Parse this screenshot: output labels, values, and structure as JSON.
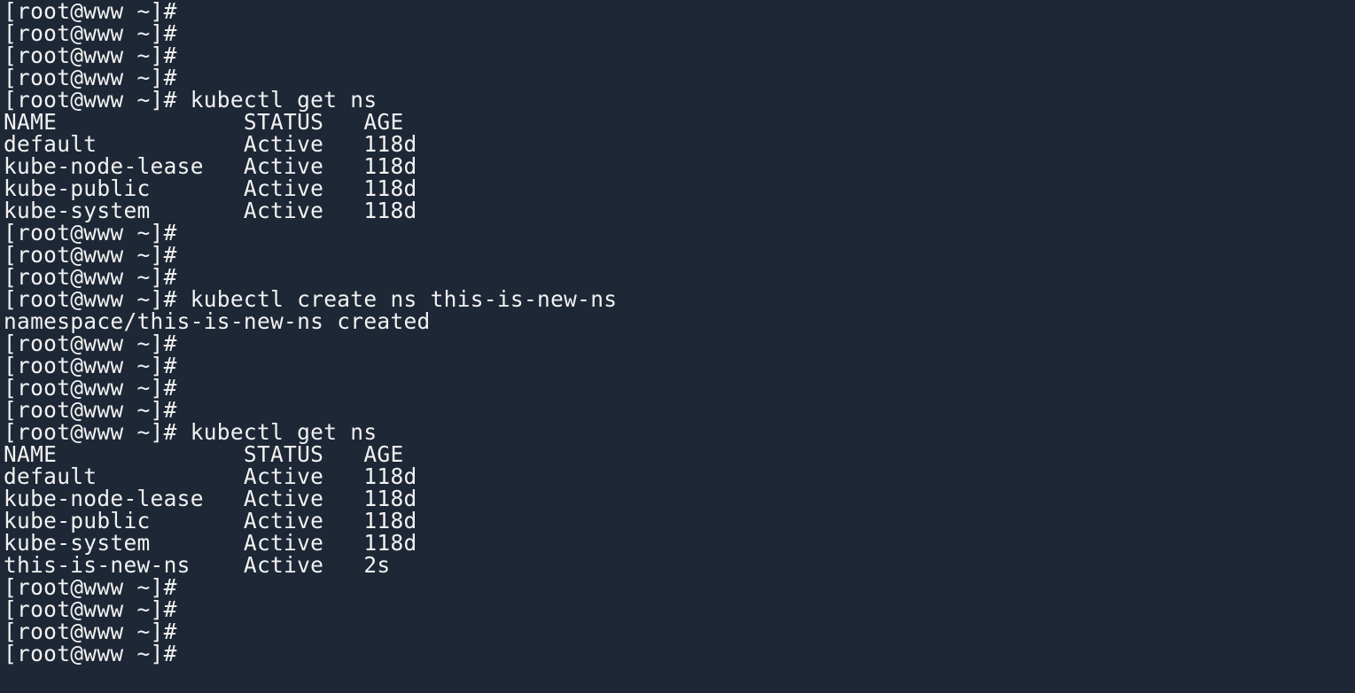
{
  "terminal": {
    "background": "#1e2735",
    "foreground": "#f2f2f2",
    "prompt": "[root@www ~]#",
    "lines": [
      {
        "type": "prompt",
        "command": ""
      },
      {
        "type": "prompt",
        "command": ""
      },
      {
        "type": "prompt",
        "command": ""
      },
      {
        "type": "prompt",
        "command": ""
      },
      {
        "type": "prompt",
        "command": " kubectl get ns"
      },
      {
        "type": "output",
        "text": "NAME              STATUS   AGE"
      },
      {
        "type": "output",
        "text": "default           Active   118d"
      },
      {
        "type": "output",
        "text": "kube-node-lease   Active   118d"
      },
      {
        "type": "output",
        "text": "kube-public       Active   118d"
      },
      {
        "type": "output",
        "text": "kube-system       Active   118d"
      },
      {
        "type": "prompt",
        "command": ""
      },
      {
        "type": "prompt",
        "command": ""
      },
      {
        "type": "prompt",
        "command": ""
      },
      {
        "type": "prompt",
        "command": " kubectl create ns this-is-new-ns"
      },
      {
        "type": "output",
        "text": "namespace/this-is-new-ns created"
      },
      {
        "type": "prompt",
        "command": ""
      },
      {
        "type": "prompt",
        "command": ""
      },
      {
        "type": "prompt",
        "command": ""
      },
      {
        "type": "prompt",
        "command": ""
      },
      {
        "type": "prompt",
        "command": " kubectl get ns"
      },
      {
        "type": "output",
        "text": "NAME              STATUS   AGE"
      },
      {
        "type": "output",
        "text": "default           Active   118d"
      },
      {
        "type": "output",
        "text": "kube-node-lease   Active   118d"
      },
      {
        "type": "output",
        "text": "kube-public       Active   118d"
      },
      {
        "type": "output",
        "text": "kube-system       Active   118d"
      },
      {
        "type": "output",
        "text": "this-is-new-ns    Active   2s"
      },
      {
        "type": "prompt",
        "command": ""
      },
      {
        "type": "prompt",
        "command": ""
      },
      {
        "type": "prompt",
        "command": ""
      },
      {
        "type": "prompt",
        "command": ""
      }
    ]
  }
}
